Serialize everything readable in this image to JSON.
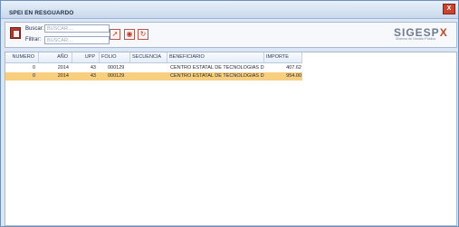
{
  "window": {
    "title": "SPEI EN RESGUARDO",
    "close_label": "X"
  },
  "toolbar": {
    "search_label": "Buscar:",
    "search_placeholder": "BUSCAR....",
    "filter_label": "Filtrar:",
    "filter_placeholder": "BUSCAR....",
    "icons": [
      "export-icon",
      "view-icon",
      "refresh-icon"
    ]
  },
  "logo": {
    "text": "SIGESP",
    "x": "X",
    "subtitle": "Sistema de Gestión Pública"
  },
  "table": {
    "headers": [
      "NUMERO",
      "AÑO",
      "UPP",
      "FOLIO",
      "SECUENCIA",
      "BENEFICIARIO",
      "IMPORTE"
    ],
    "rows": [
      [
        "0",
        "2014",
        "43",
        "000129",
        "",
        "CENTRO ESTATAL DE TECNOLOGIAS DE",
        "407.62"
      ],
      [
        "0",
        "2014",
        "43",
        "000129",
        "",
        "CENTRO ESTATAL DE TECNOLOGIAS DE",
        "954.00"
      ]
    ],
    "selected_row": 1,
    "selected_color": "#f8cf7f"
  }
}
